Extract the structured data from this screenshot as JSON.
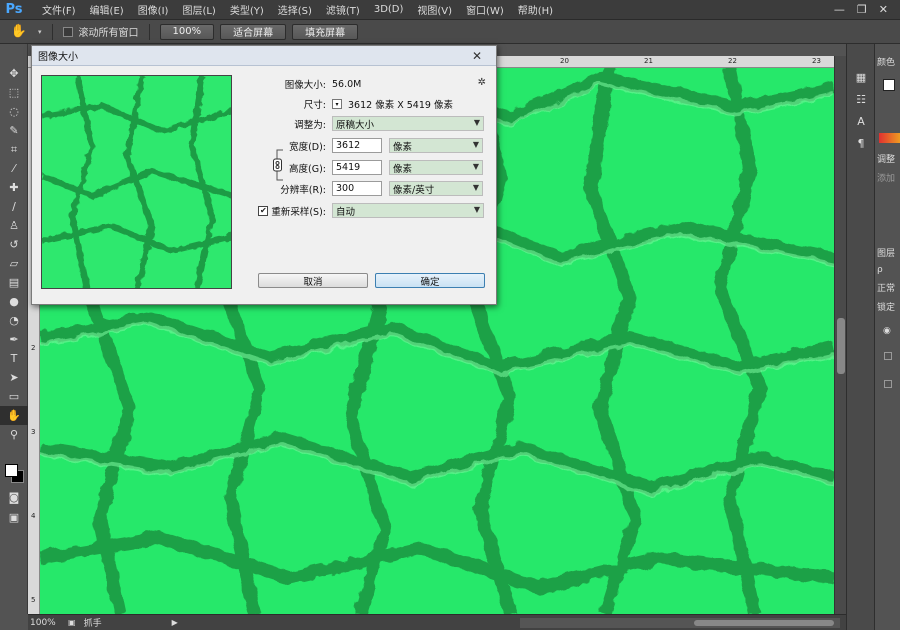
{
  "app": {
    "logo": "Ps",
    "accent": "#4aa8ff"
  },
  "menu": [
    "文件(F)",
    "编辑(E)",
    "图像(I)",
    "图层(L)",
    "类型(Y)",
    "选择(S)",
    "滤镜(T)",
    "3D(D)",
    "视图(V)",
    "窗口(W)",
    "帮助(H)"
  ],
  "window_controls": {
    "minimize": "—",
    "restore": "❐",
    "close": "✕"
  },
  "options_bar": {
    "tool_icon": "hand-icon",
    "scroll_all_label": "滚动所有窗口",
    "zoom_button": "100%",
    "fit_screen_button": "适合屏幕",
    "fill_screen_button": "填充屏幕"
  },
  "ruler": {
    "top_marks": [
      "20",
      "21",
      "22",
      "23"
    ],
    "left_marks": [
      "2",
      "3",
      "4",
      "5",
      "6"
    ]
  },
  "status_bar": {
    "zoom": "100%",
    "tool_name": "抓手"
  },
  "right_panels": {
    "color": "颜色",
    "adjust": "调整",
    "add": "添加",
    "layers": "图层",
    "search": "ρ",
    "normal": "正常",
    "lock": "锁定"
  },
  "dialog": {
    "title": "图像大小",
    "close": "✕",
    "image_size_label": "图像大小:",
    "image_size_value": "56.0M",
    "dimensions_label": "尺寸:",
    "dimensions_value": "3612 像素  X  5419 像素",
    "fit_to_label": "调整为:",
    "fit_to_value": "原稿大小",
    "width_label": "宽度(D):",
    "width_value": "3612",
    "width_unit": "像素",
    "height_label": "高度(G):",
    "height_value": "5419",
    "height_unit": "像素",
    "resolution_label": "分辨率(R):",
    "resolution_value": "300",
    "resolution_unit": "像素/英寸",
    "resample_label": "重新采样(S):",
    "resample_value": "自动",
    "resample_checked": "✔",
    "cancel_button": "取消",
    "ok_button": "确定"
  },
  "colors": {
    "canvas_green": "#26e86a",
    "crack_dark": "#1e9a46",
    "dropdown_bg": "#d3e6d3"
  }
}
